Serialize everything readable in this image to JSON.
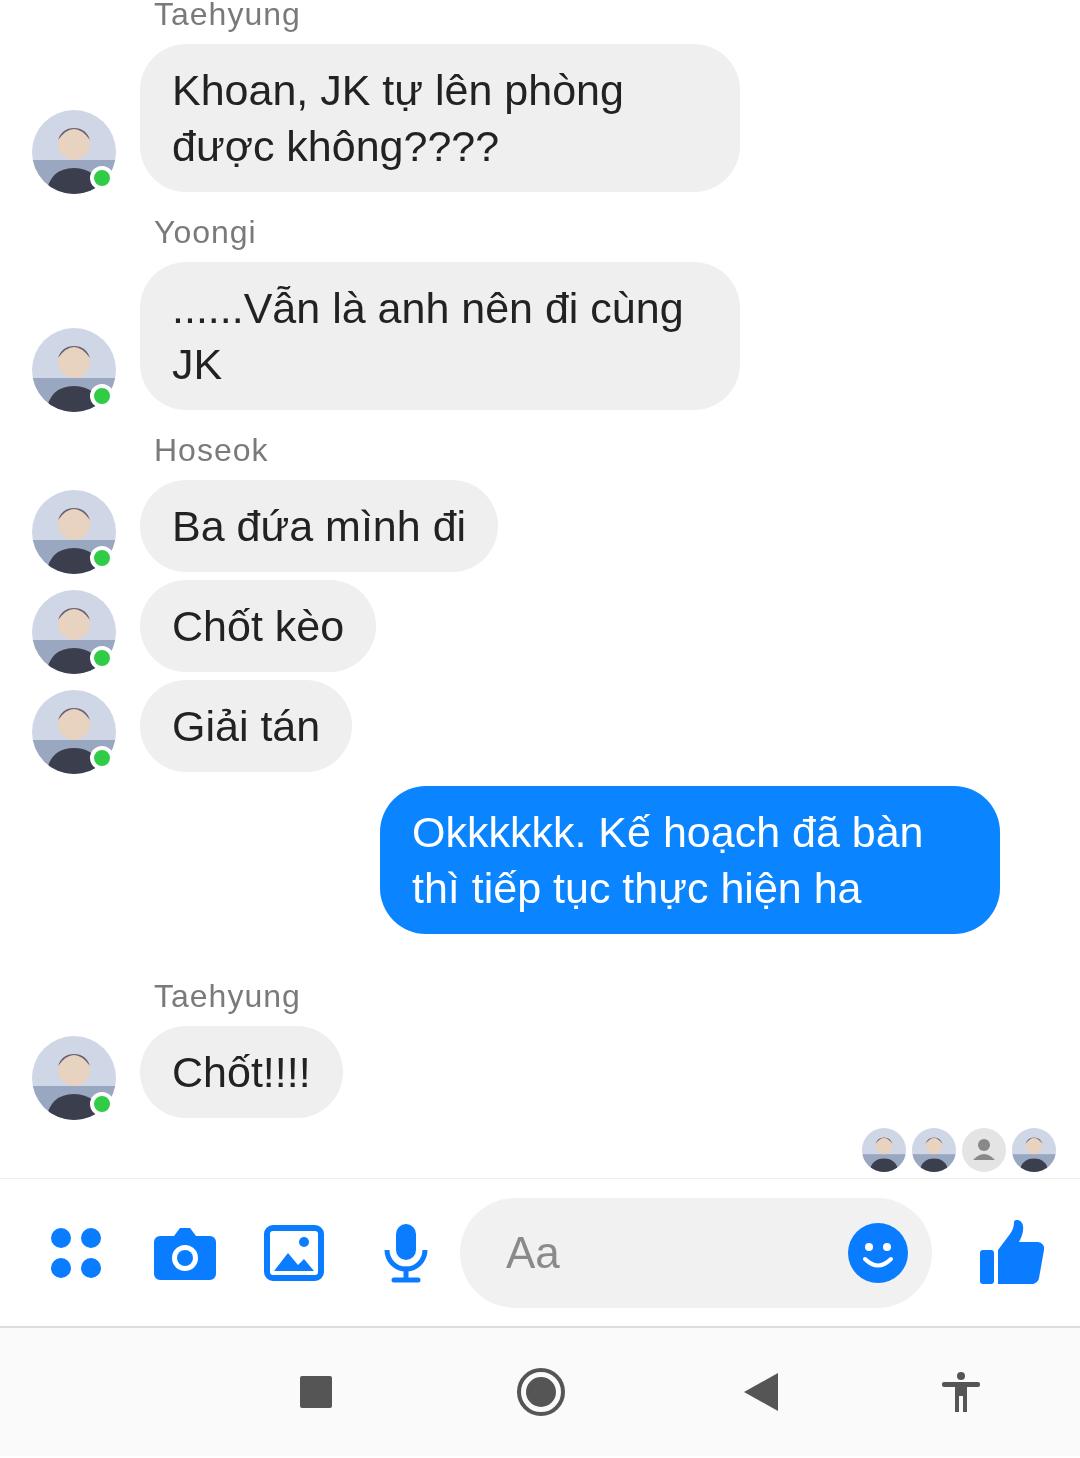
{
  "thread": [
    {
      "kind": "sender",
      "text": "Taehyung"
    },
    {
      "kind": "incoming",
      "text": "Khoan, JK tự lên phòng được không????",
      "online": true
    },
    {
      "kind": "sender",
      "text": "Yoongi"
    },
    {
      "kind": "incoming",
      "text": "......Vẫn là anh nên đi cùng JK",
      "online": true
    },
    {
      "kind": "sender",
      "text": "Hoseok"
    },
    {
      "kind": "incoming",
      "text": "Ba đứa mình đi",
      "online": true
    },
    {
      "kind": "incoming",
      "text": "Chốt kèo",
      "online": true
    },
    {
      "kind": "incoming",
      "text": "Giải tán",
      "online": true
    },
    {
      "kind": "outgoing",
      "text": "Okkkkkk. Kế hoạch đã bàn thì tiếp tục thực hiện ha"
    },
    {
      "kind": "sender",
      "text": "Taehyung"
    },
    {
      "kind": "incoming",
      "text": "Chốt!!!!",
      "online": true
    }
  ],
  "seen_by": [
    {
      "kind": "picture"
    },
    {
      "kind": "picture"
    },
    {
      "kind": "default"
    },
    {
      "kind": "picture"
    }
  ],
  "composer": {
    "placeholder": "Aa"
  }
}
